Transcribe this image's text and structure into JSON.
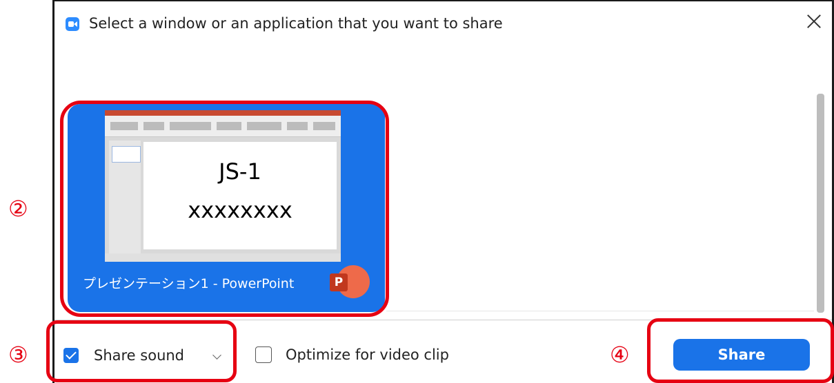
{
  "dialog": {
    "title": "Select a window or an application that you want to share",
    "close_icon": "close-icon",
    "app_icon": "zoom-icon"
  },
  "app_tile": {
    "label": "プレゼンテーション1 - PowerPoint",
    "slide_text_1": "JS-1",
    "slide_text_2": "xxxxxxxx",
    "app_icon": "powerpoint-icon",
    "app_icon_letter": "P",
    "selected": true
  },
  "footer": {
    "share_sound": {
      "label": "Share sound",
      "checked": true
    },
    "optimize": {
      "label": "Optimize for video clip",
      "checked": false
    },
    "share_button": "Share"
  },
  "annotations": {
    "num_2": "②",
    "num_3": "③",
    "num_4": "④",
    "color": "#e60012"
  },
  "colors": {
    "accent": "#1a73e8",
    "annotation": "#e60012"
  }
}
